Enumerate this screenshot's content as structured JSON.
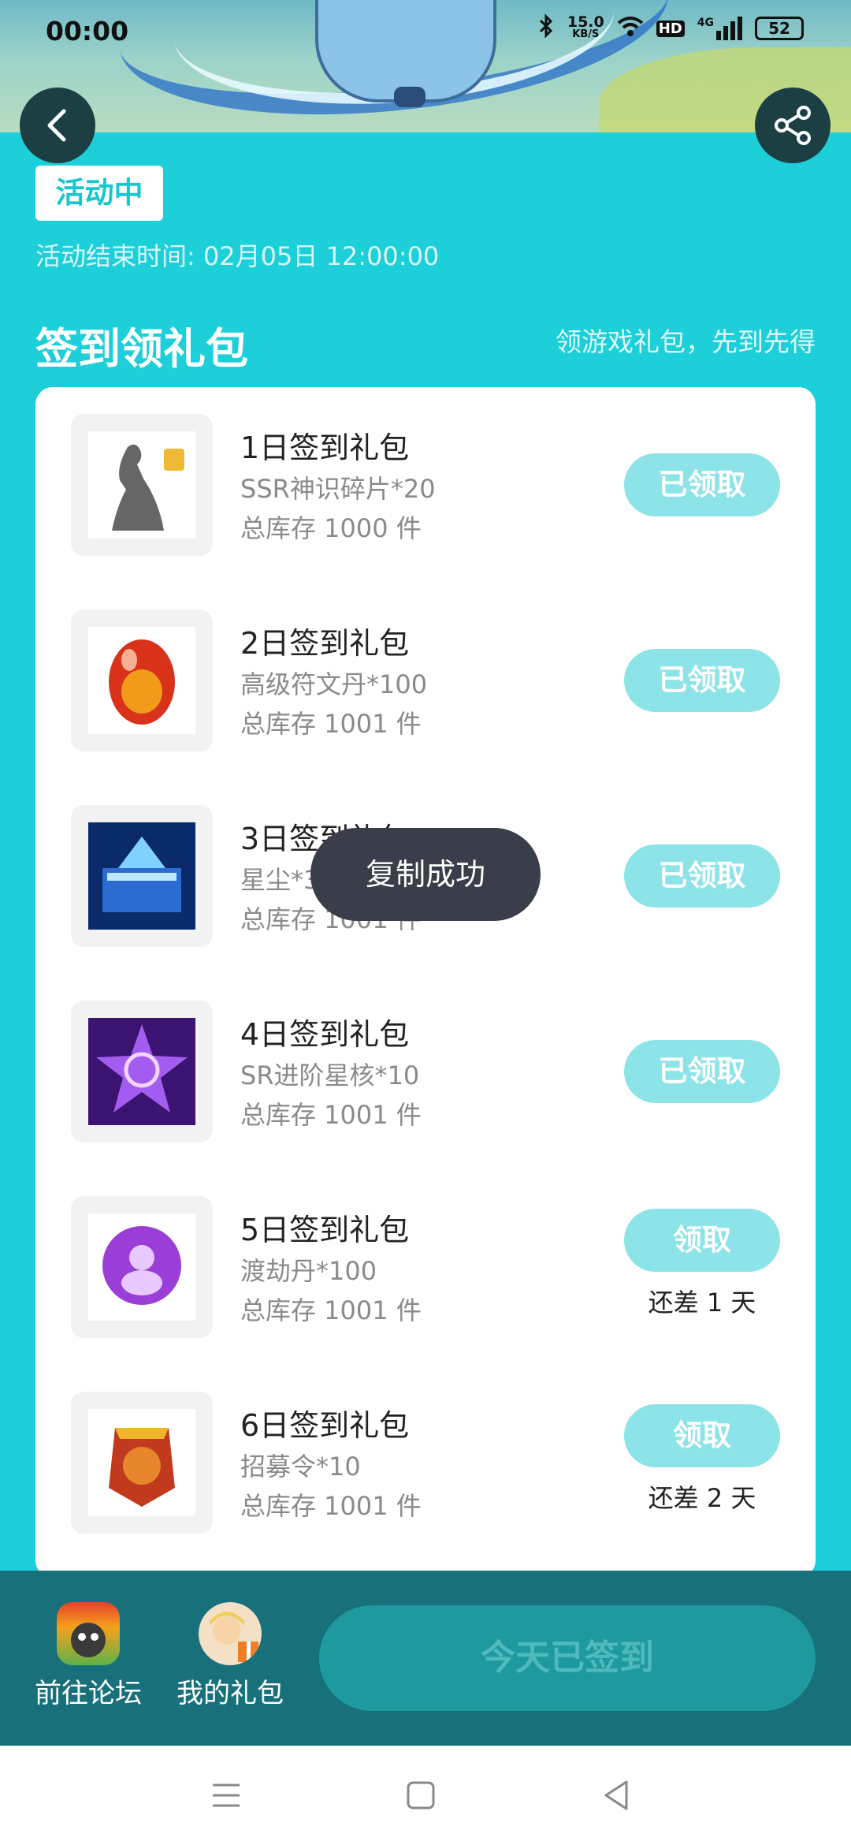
{
  "status_bar": {
    "time": "00:00",
    "speed": "15.0",
    "speed_unit": "KB/S",
    "hd": "HD",
    "network": "4G",
    "battery": "52"
  },
  "activity": {
    "badge": "活动中",
    "end_time": "活动结束时间: 02月05日 12:00:00"
  },
  "section": {
    "title": "签到领礼包",
    "subtitle": "领游戏礼包，先到先得"
  },
  "gifts": [
    {
      "title": "1日签到礼包",
      "item": "SSR神识碎片*20",
      "stock": "总库存 1000 件",
      "button": "已领取",
      "remaining": ""
    },
    {
      "title": "2日签到礼包",
      "item": "高级符文丹*100",
      "stock": "总库存 1001 件",
      "button": "已领取",
      "remaining": ""
    },
    {
      "title": "3日签到礼包",
      "item": "星尘*333",
      "stock": "总库存 1001 件",
      "button": "已领取",
      "remaining": ""
    },
    {
      "title": "4日签到礼包",
      "item": "SR进阶星核*10",
      "stock": "总库存 1001 件",
      "button": "已领取",
      "remaining": ""
    },
    {
      "title": "5日签到礼包",
      "item": "渡劫丹*100",
      "stock": "总库存 1001 件",
      "button": "领取",
      "remaining": "还差 1 天"
    },
    {
      "title": "6日签到礼包",
      "item": "招募令*10",
      "stock": "总库存 1001 件",
      "button": "领取",
      "remaining": "还差 2 天"
    }
  ],
  "toast": "复制成功",
  "bottom_bar": {
    "forum_label": "前往论坛",
    "my_gifts_label": "我的礼包",
    "sign_button": "今天已签到"
  },
  "colors": {
    "accent": "#1ccfd8",
    "button_light": "#8ce3e8",
    "bottom_bar": "#17707a"
  }
}
